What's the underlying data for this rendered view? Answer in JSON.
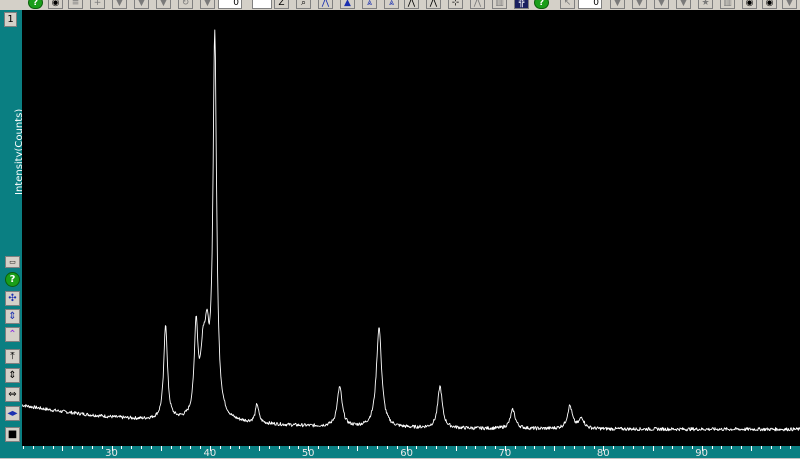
{
  "toolbar": {
    "zoom_value": "0",
    "range_value": "0",
    "z_label": "Z"
  },
  "side_panel": {
    "top_button": "1",
    "help_label": "?"
  },
  "chart_data": {
    "type": "line",
    "title": "",
    "xlabel": "",
    "ylabel": "Intensity(Counts)",
    "xlim": [
      20.9,
      100
    ],
    "ylim": [
      0,
      1000
    ],
    "grid": false,
    "x_ticks": [
      30,
      40,
      50,
      60,
      70,
      80,
      90
    ],
    "background": "#000000",
    "line_color": "#ffffff",
    "peaks": [
      {
        "x": 35.5,
        "y": 230,
        "w": 0.22
      },
      {
        "x": 38.6,
        "y": 215,
        "w": 0.22
      },
      {
        "x": 39.3,
        "y": 130,
        "w": 0.3
      },
      {
        "x": 39.7,
        "y": 150,
        "w": 0.28
      },
      {
        "x": 40.5,
        "y": 920,
        "w": 0.22
      },
      {
        "x": 44.8,
        "y": 45,
        "w": 0.2
      },
      {
        "x": 53.2,
        "y": 95,
        "w": 0.3
      },
      {
        "x": 57.2,
        "y": 240,
        "w": 0.32
      },
      {
        "x": 63.4,
        "y": 100,
        "w": 0.28
      },
      {
        "x": 70.8,
        "y": 45,
        "w": 0.3
      },
      {
        "x": 76.6,
        "y": 55,
        "w": 0.3
      },
      {
        "x": 77.8,
        "y": 25,
        "w": 0.3
      }
    ]
  }
}
